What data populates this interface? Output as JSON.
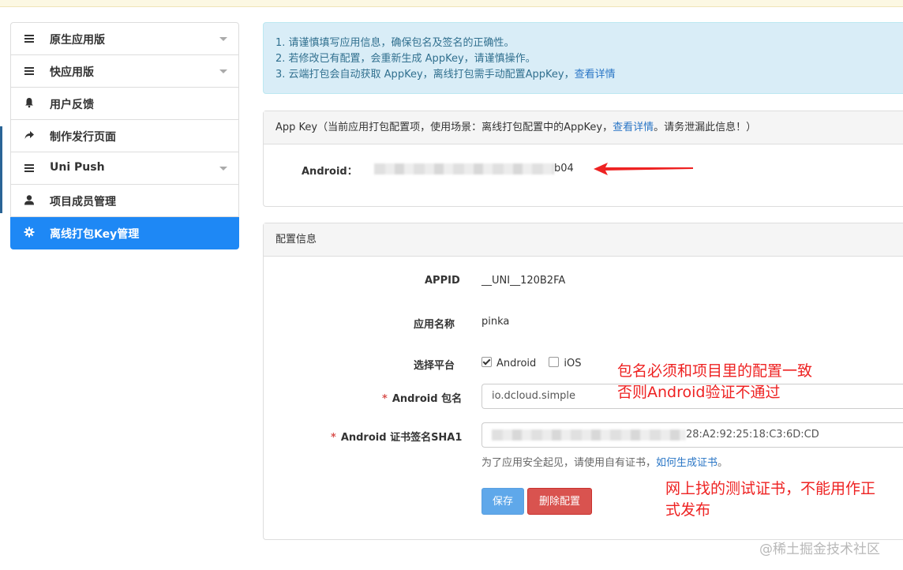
{
  "sidebar": {
    "items": [
      {
        "label": "原生应用版",
        "icon": "menu-icon",
        "has_caret": true
      },
      {
        "label": "快应用版",
        "icon": "menu-icon",
        "has_caret": true
      },
      {
        "label": "用户反馈",
        "icon": "bell-icon",
        "has_caret": false
      },
      {
        "label": "制作发行页面",
        "icon": "share-arrow-icon",
        "has_caret": false
      },
      {
        "label": "Uni Push",
        "icon": "menu-icon",
        "has_caret": true
      },
      {
        "label": "项目成员管理",
        "icon": "user-icon",
        "has_caret": false
      },
      {
        "label": "离线打包Key管理",
        "icon": "gear-icon",
        "has_caret": false,
        "active": true
      }
    ]
  },
  "alert": {
    "line1": "1. 请谨慎填写应用信息，确保包名及签名的正确性。",
    "line2": "2. 若修改已有配置，会重新生成 AppKey，请谨慎操作。",
    "line3_text": "3. 云端打包会自动获取 AppKey，离线打包需手动配置AppKey，",
    "line3_link": "查看详情"
  },
  "appkey_panel": {
    "header_prefix": "App Key（当前应用打包配置项，使用场景：离线打包配置中的AppKey，",
    "header_link": "查看详情",
    "header_suffix": "。请务泄漏此信息！）",
    "android_label": "Android：",
    "android_value_visible": "b04"
  },
  "config_panel": {
    "header": "配置信息",
    "appid_label": "APPID",
    "appid_value": "__UNI__120B2FA",
    "appname_label": "应用名称",
    "appname_value": "pinka",
    "platform_label": "选择平台",
    "platform_android": "Android",
    "platform_ios": "iOS",
    "android_checked": true,
    "ios_checked": false,
    "required_mark": "*",
    "package_label": "Android 包名",
    "package_value": "io.dcloud.simple",
    "sha1_label": "Android 证书签名SHA1",
    "sha1_value_visible": "28:A2:92:25:18:C3:6D:CD",
    "hint_text": "为了应用安全起见，请使用自有证书，",
    "hint_link": "如何生成证书",
    "hint_end": "。",
    "save_button": "保存",
    "delete_button": "删除配置"
  },
  "annotations": {
    "note1_line1": "包名必须和项目里的配置一致",
    "note1_line2": "否则Android验证不通过",
    "note2_line1": "网上找的测试证书，不能用作正",
    "note2_line2": "式发布",
    "arrow_color": "#ee2222"
  },
  "watermark": "@稀土掘金技术社区",
  "colors": {
    "primary": "#1e88f5",
    "danger": "#d9534f",
    "info_bg": "#d9edf7",
    "link": "#2a76c6"
  }
}
